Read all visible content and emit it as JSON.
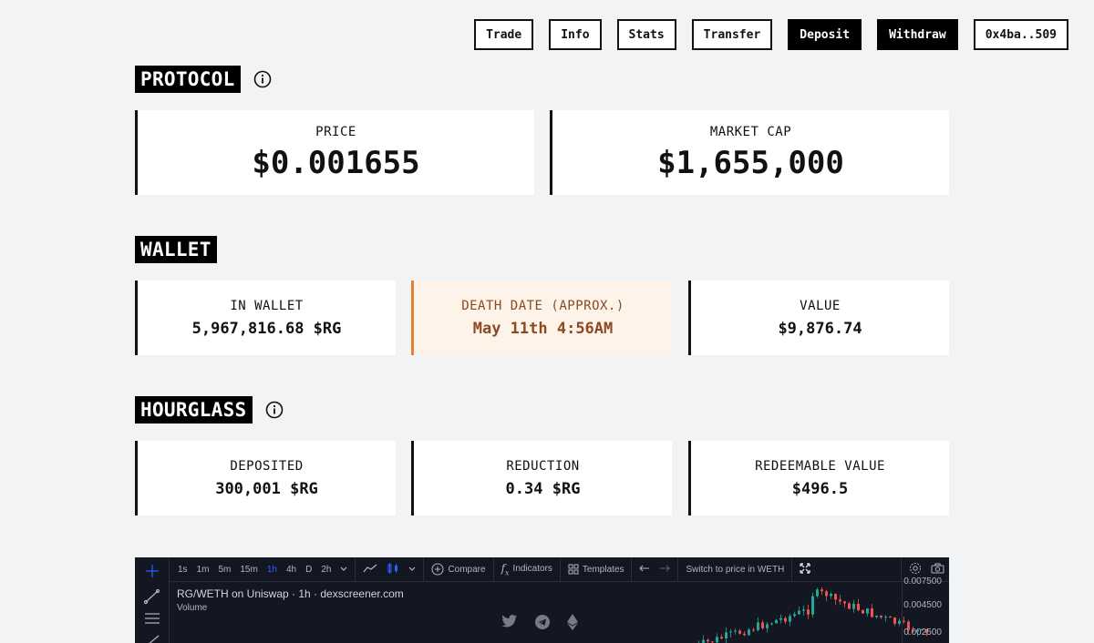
{
  "nav": {
    "items": [
      {
        "label": "Trade",
        "style": "light"
      },
      {
        "label": "Info",
        "style": "light"
      },
      {
        "label": "Stats",
        "style": "light"
      },
      {
        "label": "Transfer",
        "style": "light"
      },
      {
        "label": "Deposit",
        "style": "dark"
      },
      {
        "label": "Withdraw",
        "style": "dark"
      },
      {
        "label": "0x4ba..509",
        "style": "light"
      }
    ]
  },
  "protocol": {
    "title": "PROTOCOL",
    "price_label": "PRICE",
    "price_value": "$0.001655",
    "market_cap_label": "MARKET CAP",
    "market_cap_value": "$1,655,000"
  },
  "wallet": {
    "title": "WALLET",
    "in_wallet_label": "IN WALLET",
    "in_wallet_value": "5,967,816.68 $RG",
    "death_date_label": "DEATH DATE (APPROX.)",
    "death_date_value": "May 11th 4:56AM",
    "value_label": "VALUE",
    "value_value": "$9,876.74"
  },
  "hourglass": {
    "title": "HOURGLASS",
    "deposited_label": "DEPOSITED",
    "deposited_value": "300,001 $RG",
    "reduction_label": "REDUCTION",
    "reduction_value": "0.34 $RG",
    "redeemable_label": "REDEEMABLE VALUE",
    "redeemable_value": "$496.5"
  },
  "chart_widget": {
    "intervals": [
      "1s",
      "1m",
      "5m",
      "15m",
      "1h",
      "4h",
      "D",
      "2h"
    ],
    "active_interval": "1h",
    "compare_label": "Compare",
    "indicators_label": "Indicators",
    "templates_label": "Templates",
    "switch_label": "Switch to price in WETH",
    "pair_label": "RG/WETH on Uniswap · 1h · dexscreener.com",
    "volume_label": "Volume",
    "price_ticks": [
      "0.007500",
      "0.004500",
      "0.002500"
    ]
  },
  "colors": {
    "accent_warn": "#e2813a",
    "warn_bg": "#fdf3e8",
    "chart_bg": "#131722",
    "candle_up": "#26a69a",
    "candle_down": "#ef5350"
  }
}
